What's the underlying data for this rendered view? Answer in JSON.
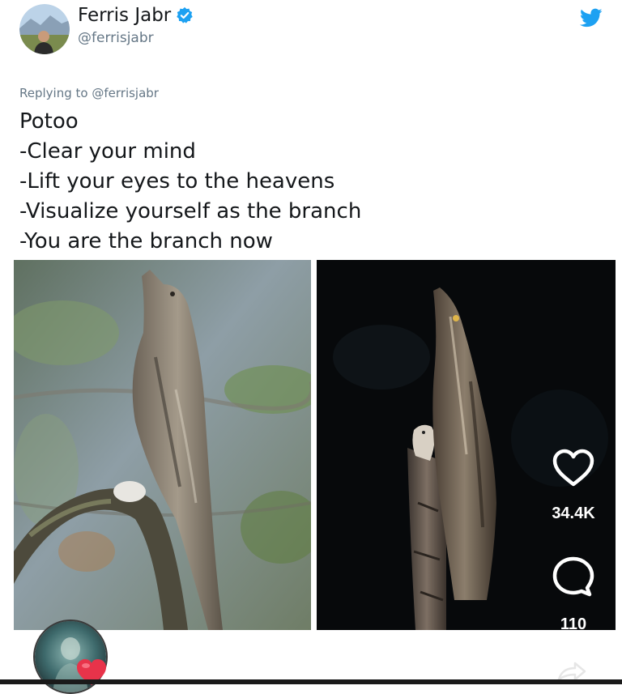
{
  "author": {
    "name": "Ferris Jabr",
    "handle": "@ferrisjabr",
    "avatar_icon": "profile-photo",
    "verified_icon": "verified-badge-icon"
  },
  "brand": {
    "icon": "twitter-bird-icon",
    "color": "#1da1f2"
  },
  "reply": {
    "prefix": "Replying to",
    "handle": "@ferrisjabr"
  },
  "tweet": {
    "lines": [
      "Potoo",
      "-Clear your mind",
      "-Lift your eyes to the heavens",
      "-Visualize yourself as the branch",
      "-You are the branch now"
    ]
  },
  "media": {
    "left_photo": "potoo-on-branch-photo",
    "right_photo": "potoo-on-stump-photo"
  },
  "overlay": {
    "like_icon": "heart-outline-icon",
    "like_count": "34.4K",
    "comment_icon": "comment-bubble-icon",
    "comment_count": "110",
    "share_icon": "share-icon"
  }
}
